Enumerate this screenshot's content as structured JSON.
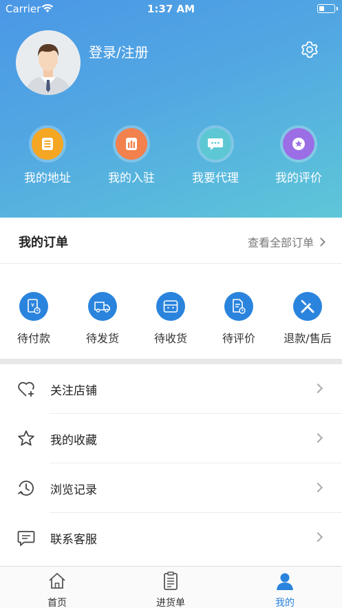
{
  "status_bar": {
    "carrier": "Carrier",
    "time": "1:37 AM"
  },
  "profile": {
    "login_label": "登录/注册"
  },
  "quick_actions": [
    {
      "label": "我的地址",
      "color": "#f5a623"
    },
    {
      "label": "我的入驻",
      "color": "#f2814d"
    },
    {
      "label": "我要代理",
      "color": "#5dc8d3"
    },
    {
      "label": "我的评价",
      "color": "#9c6ee6"
    }
  ],
  "orders": {
    "title": "我的订单",
    "view_all": "查看全部订单",
    "items": [
      {
        "label": "待付款"
      },
      {
        "label": "待发货"
      },
      {
        "label": "待收货"
      },
      {
        "label": "待评价"
      },
      {
        "label": "退款/售后"
      }
    ]
  },
  "menu": [
    {
      "label": "关注店铺"
    },
    {
      "label": "我的收藏"
    },
    {
      "label": "浏览记录"
    },
    {
      "label": "联系客服"
    }
  ],
  "tabbar": {
    "items": [
      {
        "label": "首页"
      },
      {
        "label": "进货单"
      },
      {
        "label": "我的"
      }
    ],
    "active_color": "#2a84dd"
  },
  "colors": {
    "accent": "#2a84dd"
  }
}
